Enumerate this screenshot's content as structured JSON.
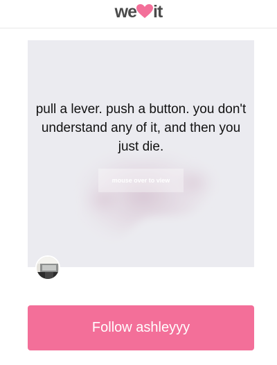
{
  "header": {
    "logo_left": "we",
    "logo_right": "it"
  },
  "post": {
    "quote": "pull a lever. push a button. you don't understand any of it, and then you just die.",
    "hover_hint": "mouse over to view"
  },
  "follow": {
    "label": "Follow ashleyyy"
  },
  "colors": {
    "brand_pink": "#f36f99",
    "logo_text": "#4a4a4a",
    "card_bg": "#ececf0"
  }
}
